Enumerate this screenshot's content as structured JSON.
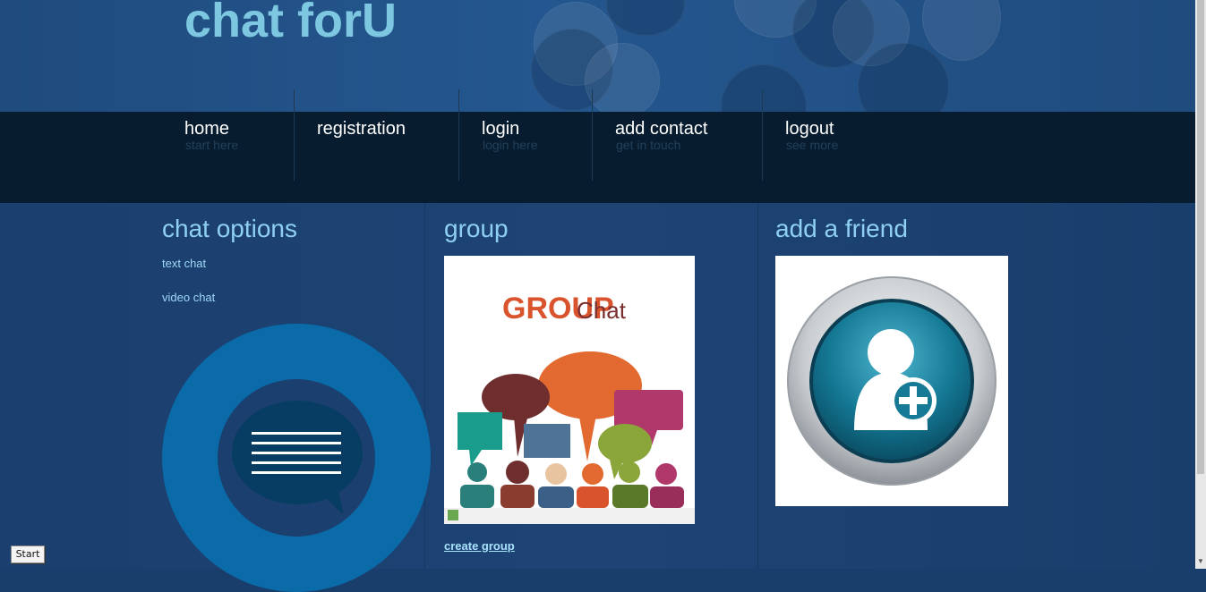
{
  "site": {
    "title": "chat forU"
  },
  "nav": [
    {
      "label": "home",
      "sub": "start here"
    },
    {
      "label": "registration",
      "sub": ""
    },
    {
      "label": "login",
      "sub": "login here"
    },
    {
      "label": "add contact",
      "sub": "get in touch"
    },
    {
      "label": "logout",
      "sub": "see more"
    }
  ],
  "chat_options": {
    "title": "chat options",
    "links": [
      "text chat",
      "video chat"
    ]
  },
  "group": {
    "title": "group",
    "image_text": "GROUP Chat",
    "link": "create group"
  },
  "add_friend": {
    "title": "add a friend"
  },
  "taskbar": {
    "start_label": "Start"
  },
  "colors": {
    "header_bg": "#24578f",
    "title": "#7ec7e0",
    "nav_bg": "#071c2e",
    "content_bg": "#1b3f6e",
    "accent": "#0a6ba8"
  }
}
